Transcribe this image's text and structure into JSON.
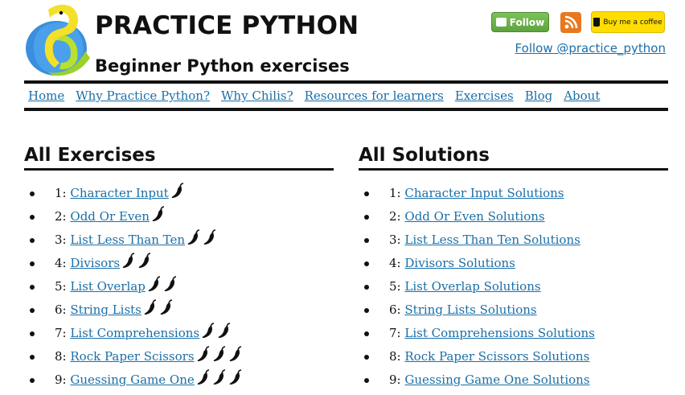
{
  "header": {
    "title": "PRACTICE PYTHON",
    "subtitle": "Beginner Python exercises",
    "follow_button_label": "Follow",
    "coffee_button_label": "Buy me a coffee",
    "follow_link": "Follow @practice_python"
  },
  "nav": {
    "items": [
      {
        "label": "Home"
      },
      {
        "label": "Why Practice Python?"
      },
      {
        "label": "Why Chilis?"
      },
      {
        "label": "Resources for learners"
      },
      {
        "label": "Exercises"
      },
      {
        "label": "Blog"
      },
      {
        "label": "About"
      }
    ]
  },
  "exercises": {
    "heading": "All Exercises",
    "items": [
      {
        "num": "1:",
        "title": "Character Input",
        "chilis": 1
      },
      {
        "num": "2:",
        "title": "Odd Or Even",
        "chilis": 1
      },
      {
        "num": "3:",
        "title": "List Less Than Ten",
        "chilis": 2
      },
      {
        "num": "4:",
        "title": "Divisors",
        "chilis": 2
      },
      {
        "num": "5:",
        "title": "List Overlap",
        "chilis": 2
      },
      {
        "num": "6:",
        "title": "String Lists",
        "chilis": 2
      },
      {
        "num": "7:",
        "title": "List Comprehensions",
        "chilis": 2
      },
      {
        "num": "8:",
        "title": "Rock Paper Scissors",
        "chilis": 3
      },
      {
        "num": "9:",
        "title": "Guessing Game One",
        "chilis": 3
      }
    ]
  },
  "solutions": {
    "heading": "All Solutions",
    "items": [
      {
        "num": "1:",
        "title": "Character Input Solutions"
      },
      {
        "num": "2:",
        "title": "Odd Or Even Solutions"
      },
      {
        "num": "3:",
        "title": "List Less Than Ten Solutions"
      },
      {
        "num": "4:",
        "title": "Divisors Solutions"
      },
      {
        "num": "5:",
        "title": "List Overlap Solutions"
      },
      {
        "num": "6:",
        "title": "String Lists Solutions"
      },
      {
        "num": "7:",
        "title": "List Comprehensions Solutions"
      },
      {
        "num": "8:",
        "title": "Rock Paper Scissors Solutions"
      },
      {
        "num": "9:",
        "title": "Guessing Game One Solutions"
      }
    ]
  },
  "colors": {
    "link": "#1a6fa8",
    "rule": "#111111",
    "follow_green": "#6bb34a",
    "rss_orange": "#e8781f",
    "coffee_yellow": "#ffdd00"
  },
  "icons": [
    "python-logo-icon",
    "twitter-bird-icon",
    "rss-icon",
    "coffee-cup-icon",
    "chili-pepper-icon"
  ]
}
